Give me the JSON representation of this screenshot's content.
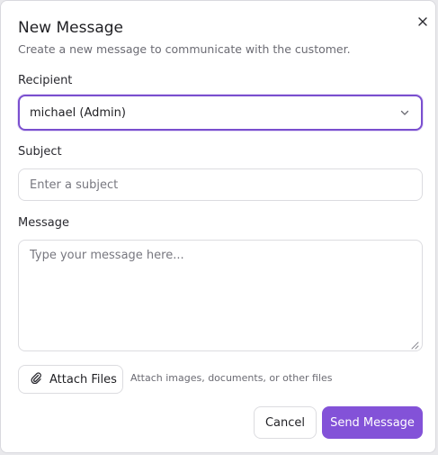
{
  "dialog": {
    "title": "New Message",
    "subtitle": "Create a new message to communicate with the customer.",
    "close_icon": "close-icon"
  },
  "recipient": {
    "label": "Recipient",
    "selected": "michael (Admin)",
    "icon": "chevron-down-icon",
    "accent_color": "#7a4fcf"
  },
  "subject": {
    "label": "Subject",
    "value": "",
    "placeholder": "Enter a subject"
  },
  "message": {
    "label": "Message",
    "value": "",
    "placeholder": "Type your message here..."
  },
  "attachments": {
    "button_label": "Attach Files",
    "icon": "paperclip-icon",
    "hint": "Attach images, documents, or other files"
  },
  "actions": {
    "cancel_label": "Cancel",
    "send_label": "Send Message",
    "send_color": "#8352d8"
  }
}
